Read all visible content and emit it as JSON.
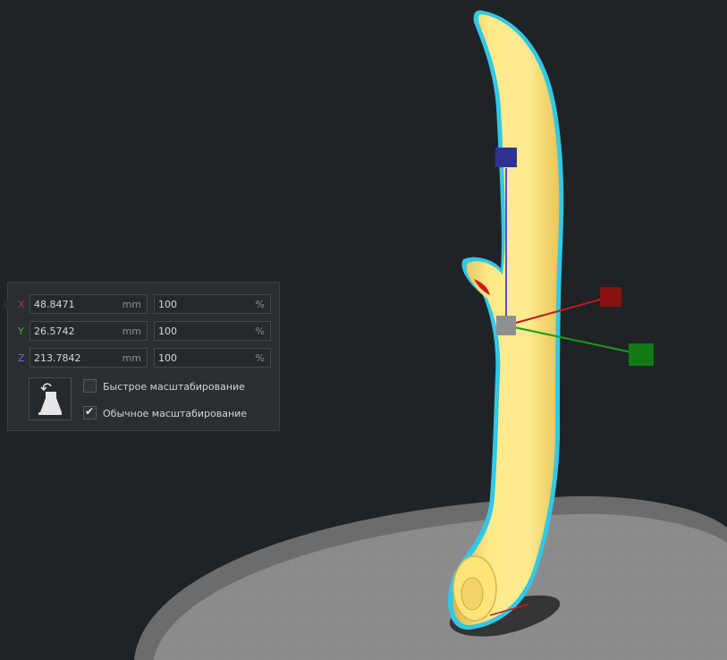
{
  "scale_tool": {
    "unit_mm": "mm",
    "unit_percent": "%",
    "x": {
      "label": "X",
      "value_mm": "48.8471",
      "value_percent": "100",
      "color": "#d22f2f"
    },
    "y": {
      "label": "Y",
      "value_mm": "26.5742",
      "value_percent": "100",
      "color": "#3fb43f"
    },
    "z": {
      "label": "Z",
      "value_mm": "213.7842",
      "value_percent": "100",
      "color": "#5a5ad6"
    },
    "uniform_scaling_icon": "uniform-scaling-icon",
    "options": [
      {
        "label": "Быстрое масштабирование",
        "checked": false
      },
      {
        "label": "Обычное масштабирование",
        "checked": true
      }
    ]
  },
  "scene": {
    "model_color": "#ffe27a",
    "outline_color": "#32c8e6",
    "build_plate_color": "#8f8f8f"
  }
}
